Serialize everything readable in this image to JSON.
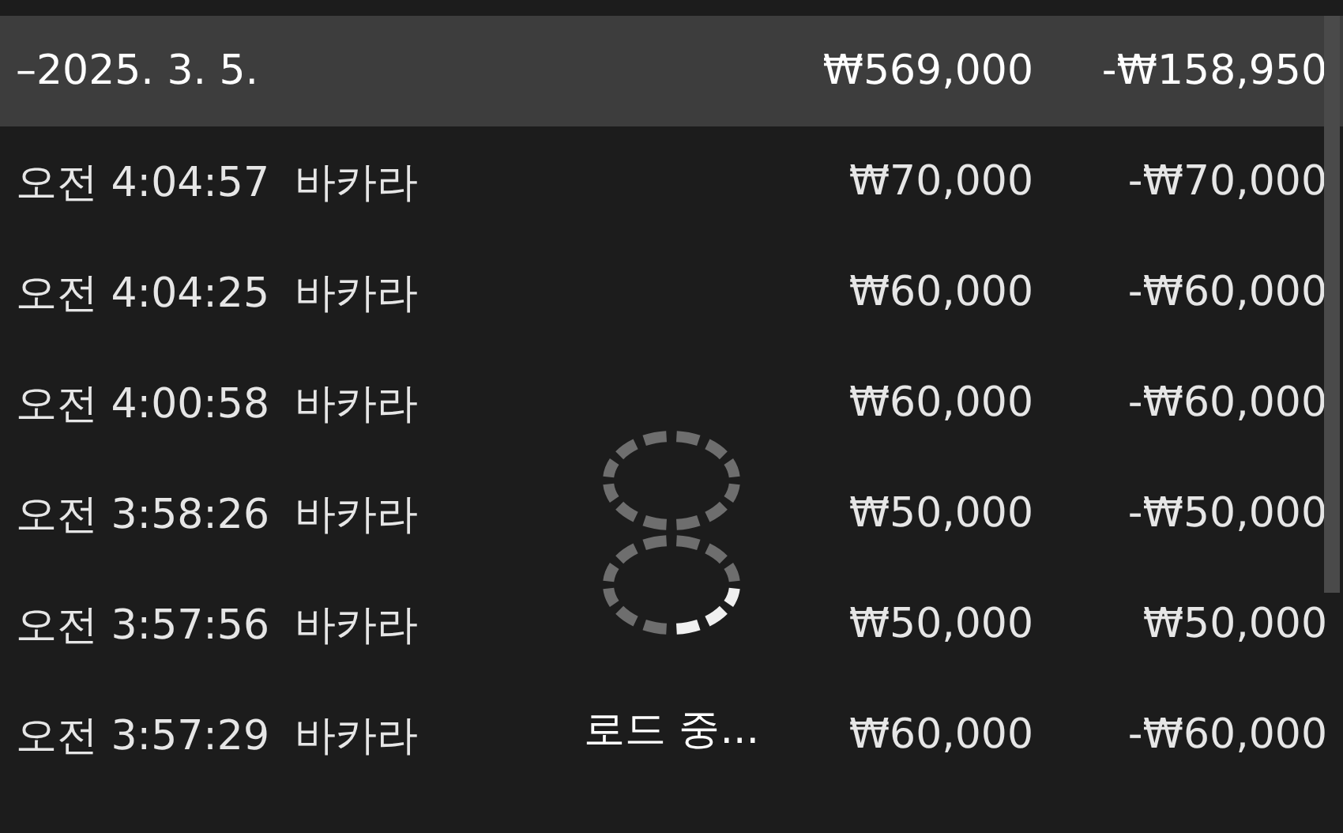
{
  "group": {
    "date": "–2025. 3. 5.",
    "amount": "₩569,000",
    "net": "-₩158,950"
  },
  "rows": [
    {
      "time": "오전 4:04:57",
      "game": "바카라",
      "amount": "₩70,000",
      "net": "-₩70,000"
    },
    {
      "time": "오전 4:04:25",
      "game": "바카라",
      "amount": "₩60,000",
      "net": "-₩60,000"
    },
    {
      "time": "오전 4:00:58",
      "game": "바카라",
      "amount": "₩60,000",
      "net": "-₩60,000"
    },
    {
      "time": "오전 3:58:26",
      "game": "바카라",
      "amount": "₩50,000",
      "net": "-₩50,000"
    },
    {
      "time": "오전 3:57:56",
      "game": "바카라",
      "amount": "₩50,000",
      "net": "₩50,000"
    },
    {
      "time": "오전 3:57:29",
      "game": "바카라",
      "amount": "₩60,000",
      "net": "-₩60,000"
    }
  ],
  "loading": {
    "label": "로드 중..."
  }
}
